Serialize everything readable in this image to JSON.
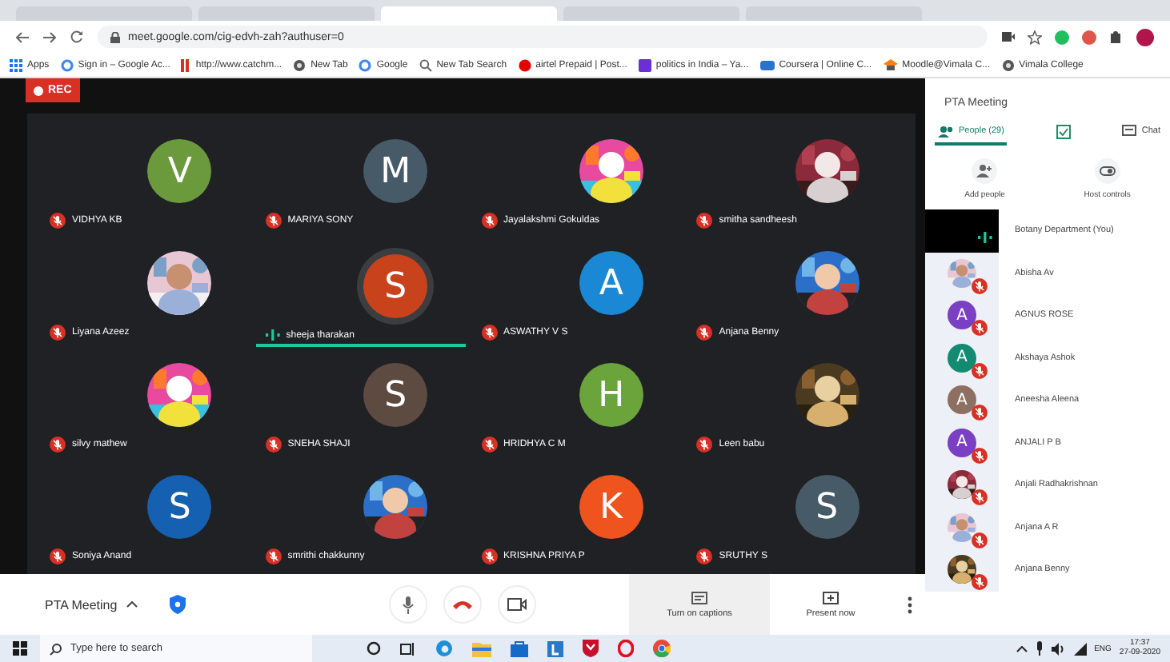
{
  "browser": {
    "tabs": [
      {
        "selected": false
      },
      {
        "selected": false
      },
      {
        "selected": true
      },
      {
        "selected": false
      },
      {
        "selected": false
      }
    ],
    "address": "meet.google.com/cig-edvh-zah?authuser=0",
    "bookmarks": [
      {
        "label": "Apps",
        "kind": "apps"
      },
      {
        "label": "Sign in – Google Ac...",
        "kind": "google"
      },
      {
        "label": "http://www.catchm...",
        "kind": "bar"
      },
      {
        "label": "New Tab",
        "kind": "globe"
      },
      {
        "label": "Google",
        "kind": "google"
      },
      {
        "label": "New Tab Search",
        "kind": "search"
      },
      {
        "label": "airtel Prepaid | Post...",
        "kind": "airtel"
      },
      {
        "label": "politics in India – Ya...",
        "kind": "purple"
      },
      {
        "label": "Coursera | Online C...",
        "kind": "coursera"
      },
      {
        "label": "Moodle@Vimala C...",
        "kind": "moodle"
      },
      {
        "label": "Vimala College",
        "kind": "globe"
      }
    ]
  },
  "rec_label": "REC",
  "tiles": [
    {
      "name": "VIDHYA KB",
      "avatar": {
        "kind": "letter",
        "letter": "V",
        "color": "#6b9a3c"
      },
      "muted": true,
      "speaking": false
    },
    {
      "name": "MARIYA SONY",
      "avatar": {
        "kind": "letter",
        "letter": "M",
        "color": "#475a68"
      },
      "muted": true,
      "speaking": false
    },
    {
      "name": "Jayalakshmi Gokuldas",
      "muted": true,
      "speaking": false
    },
    {
      "name": "smitha sandheesh",
      "muted": true,
      "speaking": false
    },
    {
      "name": "Liyana Azeez",
      "muted": true,
      "speaking": false
    },
    {
      "name": "sheeja tharakan",
      "avatar": {
        "kind": "letter",
        "letter": "S",
        "color": "#c8421c"
      },
      "muted": false,
      "speaking": true
    },
    {
      "name": "ASWATHY V S",
      "avatar": {
        "kind": "letter",
        "letter": "A",
        "color": "#1b88d6"
      },
      "muted": true,
      "speaking": false
    },
    {
      "name": "Anjana Benny",
      "muted": true,
      "speaking": false
    },
    {
      "name": "silvy mathew",
      "muted": true,
      "speaking": false
    },
    {
      "name": "SNEHA SHAJI",
      "avatar": {
        "kind": "letter",
        "letter": "S",
        "color": "#5d4a40"
      },
      "muted": true,
      "speaking": false
    },
    {
      "name": "HRIDHYA C M",
      "avatar": {
        "kind": "letter",
        "letter": "H",
        "color": "#6aa43a"
      },
      "muted": true,
      "speaking": false
    },
    {
      "name": "Leen babu",
      "muted": true,
      "speaking": false
    },
    {
      "name": "Soniya Anand",
      "avatar": {
        "kind": "letter",
        "letter": "S",
        "color": "#1560b0"
      },
      "muted": true,
      "speaking": false
    },
    {
      "name": "smrithi chakkunny",
      "muted": true,
      "speaking": false
    },
    {
      "name": "KRISHNA PRIYA P",
      "avatar": {
        "kind": "letter",
        "letter": "K",
        "color": "#f0541e"
      },
      "muted": true,
      "speaking": false
    },
    {
      "name": "SRUTHY S",
      "avatar": {
        "kind": "letter",
        "letter": "S",
        "color": "#475a68"
      },
      "muted": true,
      "speaking": false
    }
  ],
  "panel": {
    "title": "PTA Meeting",
    "tabs": [
      {
        "label": "People (29)",
        "kind": "people",
        "selected": true
      },
      {
        "kind": "tasks",
        "selected": false
      },
      {
        "label": "Chat",
        "kind": "chat",
        "selected": false
      }
    ],
    "actions": [
      {
        "label": "Add people",
        "kind": "add"
      },
      {
        "label": "Host controls",
        "kind": "host"
      }
    ],
    "people": [
      {
        "name": "Botany Department (You)",
        "avatar": {
          "kind": "video"
        },
        "muted": false,
        "speaking": true
      },
      {
        "name": "Abisha Av",
        "muted": true,
        "speaking": false
      },
      {
        "name": "AGNUS ROSE",
        "avatar": {
          "kind": "letter",
          "letter": "A",
          "color": "#7b3fc4"
        },
        "muted": true,
        "speaking": false
      },
      {
        "name": "Akshaya Ashok",
        "avatar": {
          "kind": "letter",
          "letter": "A",
          "color": "#138a72"
        },
        "muted": true,
        "speaking": false
      },
      {
        "name": "Aneesha Aleena",
        "avatar": {
          "kind": "letter",
          "letter": "A",
          "color": "#8d7062"
        },
        "muted": true,
        "speaking": false
      },
      {
        "name": "ANJALI P B",
        "avatar": {
          "kind": "letter",
          "letter": "A",
          "color": "#7b3fc4"
        },
        "muted": true,
        "speaking": false
      },
      {
        "name": "Anjali Radhakrishnan",
        "muted": true,
        "speaking": false
      },
      {
        "name": "Anjana A R",
        "muted": true,
        "speaking": false
      },
      {
        "name": "Anjana Benny",
        "muted": true,
        "speaking": false
      }
    ]
  },
  "bottom_bar": {
    "meeting_name": "PTA Meeting",
    "captions": "Turn on captions",
    "present": "Present now"
  },
  "taskbar": {
    "search_placeholder": "Type here to search",
    "language": "ENG",
    "time": "17:37",
    "date": "27-09-2020"
  }
}
